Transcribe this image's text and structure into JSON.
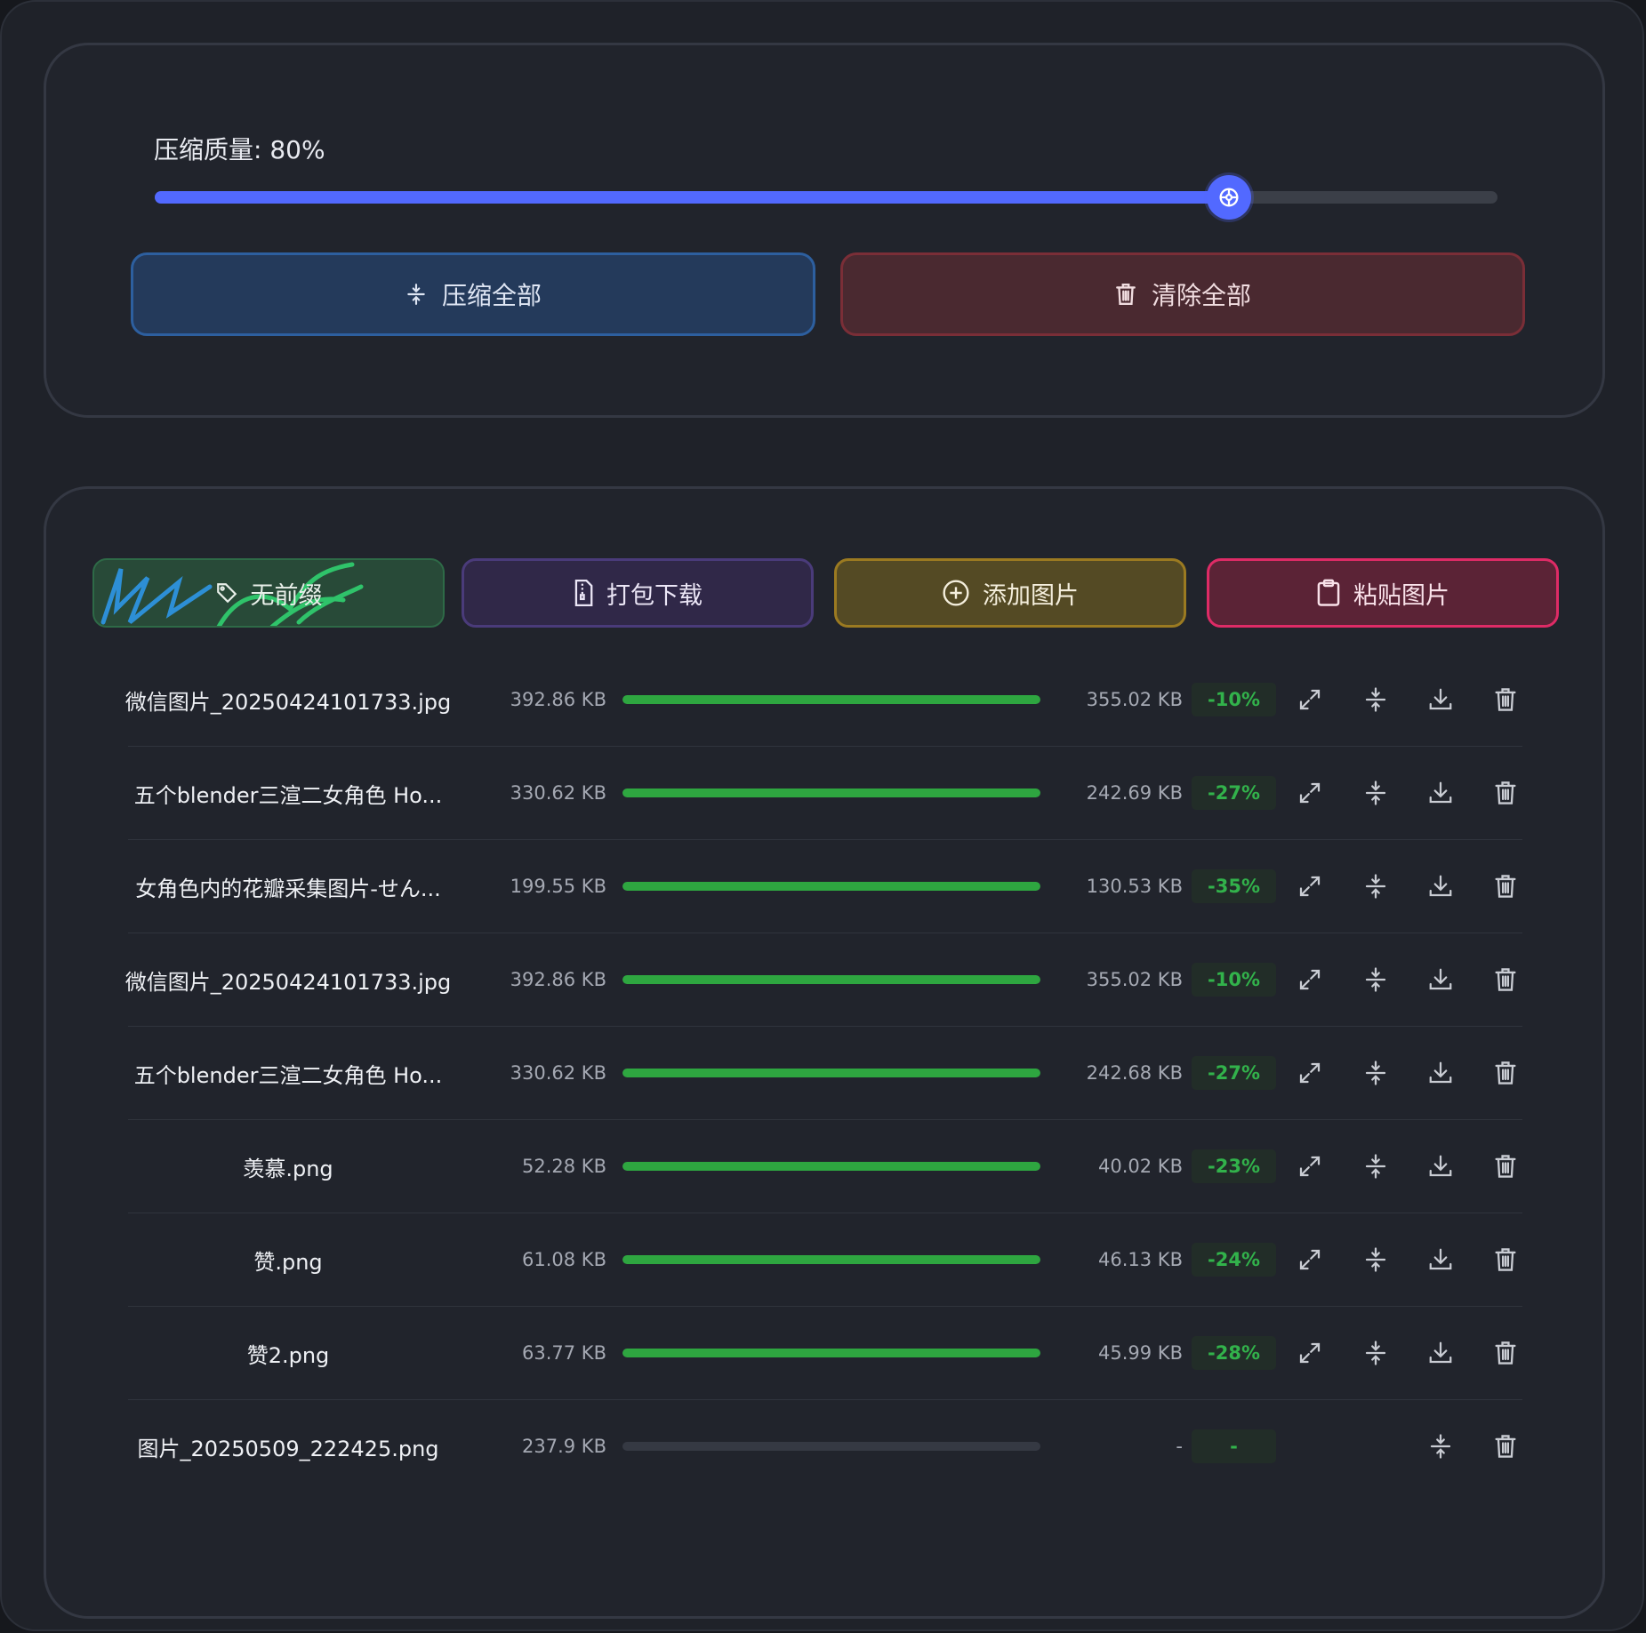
{
  "settings": {
    "quality_label": "压缩质量: 80%",
    "quality_value": 80,
    "accent_color": "#5269ff"
  },
  "actions": {
    "compress_all": "压缩全部",
    "clear_all": "清除全部"
  },
  "toolbar": {
    "prefix": "无前缀",
    "pack_download": "打包下载",
    "add_images": "添加图片",
    "paste_images": "粘贴图片"
  },
  "files": [
    {
      "name": "微信图片_20250424101733.jpg",
      "original_size": "392.86 KB",
      "progress": 100,
      "compressed_size": "355.02 KB",
      "ratio": "-10%",
      "compressed": true
    },
    {
      "name": "五个blender三渲二女角色 Ho...",
      "original_size": "330.62 KB",
      "progress": 100,
      "compressed_size": "242.69 KB",
      "ratio": "-27%",
      "compressed": true
    },
    {
      "name": "女角色内的花瓣采集图片-せん...",
      "original_size": "199.55 KB",
      "progress": 100,
      "compressed_size": "130.53 KB",
      "ratio": "-35%",
      "compressed": true
    },
    {
      "name": "微信图片_20250424101733.jpg",
      "original_size": "392.86 KB",
      "progress": 100,
      "compressed_size": "355.02 KB",
      "ratio": "-10%",
      "compressed": true
    },
    {
      "name": "五个blender三渲二女角色 Ho...",
      "original_size": "330.62 KB",
      "progress": 100,
      "compressed_size": "242.68 KB",
      "ratio": "-27%",
      "compressed": true
    },
    {
      "name": "羡慕.png",
      "original_size": "52.28 KB",
      "progress": 100,
      "compressed_size": "40.02 KB",
      "ratio": "-23%",
      "compressed": true
    },
    {
      "name": "赞.png",
      "original_size": "61.08 KB",
      "progress": 100,
      "compressed_size": "46.13 KB",
      "ratio": "-24%",
      "compressed": true
    },
    {
      "name": "赞2.png",
      "original_size": "63.77 KB",
      "progress": 100,
      "compressed_size": "45.99 KB",
      "ratio": "-28%",
      "compressed": true
    },
    {
      "name": "图片_20250509_222425.png",
      "original_size": "237.9 KB",
      "progress": 0,
      "compressed_size": "-",
      "ratio": "-",
      "compressed": false
    }
  ],
  "icons": {
    "row_actions": [
      "expand-icon",
      "compress-icon",
      "download-icon",
      "trash-icon"
    ],
    "pending_actions": [
      "compress-icon",
      "trash-icon"
    ]
  }
}
